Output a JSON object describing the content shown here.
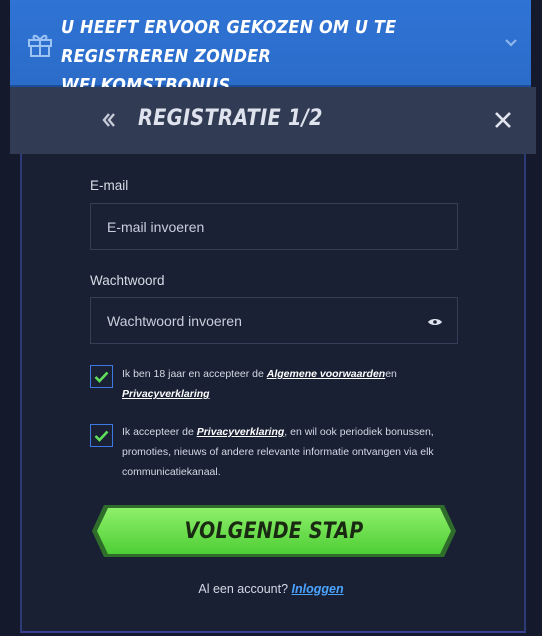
{
  "banner": {
    "title_line1": "U HEEFT ERVOOR GEKOZEN OM U TE REGISTREREN ZONDER",
    "title_line2": "WELKOMSTBONUS",
    "icon": "gift-icon",
    "toggle_icon": "chevron-down-icon"
  },
  "header": {
    "title": "REGISTRATIE 1/2",
    "back_icon": "chevron-left-icon",
    "close_icon": "close-icon"
  },
  "form": {
    "email_label": "E-mail",
    "email_placeholder": "E-mail invoeren",
    "password_label": "Wachtwoord",
    "password_placeholder": "Wachtwoord invoeren",
    "password_toggle_icon": "eye-icon",
    "terms": {
      "checked": true,
      "text_before": "Ik ben 18 jaar en accepteer de ",
      "link1": "Algemene voorwaarden",
      "text_mid": "en",
      "link2": "Privacyverklaring"
    },
    "marketing": {
      "checked": true,
      "text_before": "Ik accepteer de ",
      "link": "Privacyverklaring",
      "text_line1_after": ", en wil ook periodiek bonussen,",
      "text_line2": "promoties, nieuws of andere relevante informatie ontvangen via elk",
      "text_line3": "communicatiekanaal."
    },
    "next_button": "VOLGENDE STAP"
  },
  "footer": {
    "account_text": "Al een account?",
    "login_link": "Inloggen"
  },
  "colors": {
    "banner": "#2f73d4",
    "background": "#141a2c",
    "header": "#313b54",
    "cta_green": "#6ce14a",
    "checkbox_accent": "#3d79e0",
    "link_blue": "#4aa3ff"
  }
}
